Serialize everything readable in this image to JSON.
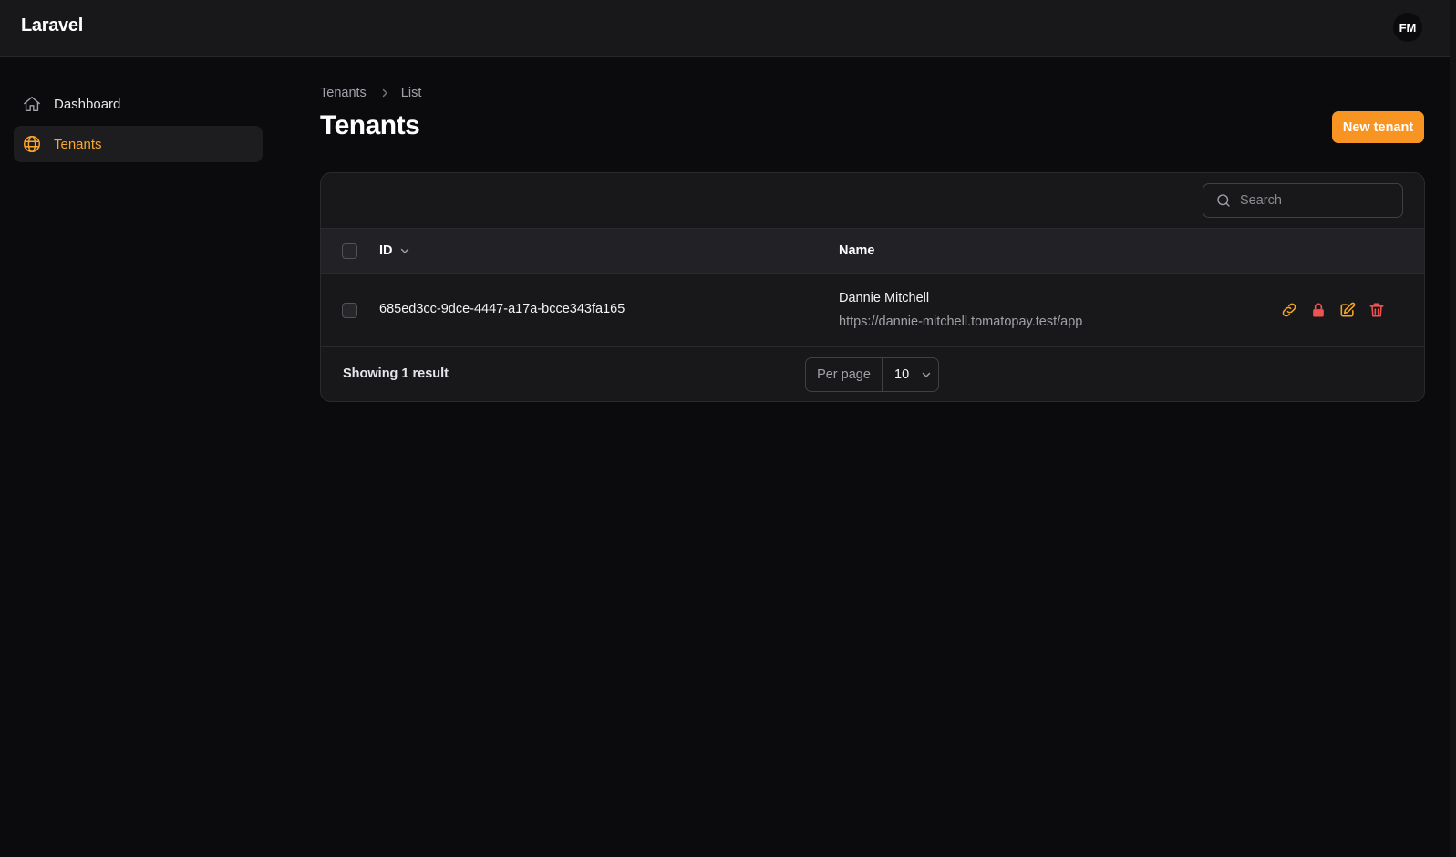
{
  "app": {
    "brand": "Laravel",
    "avatar_initials": "FM"
  },
  "sidebar": {
    "items": [
      {
        "label": "Dashboard",
        "icon": "home-icon",
        "active": false
      },
      {
        "label": "Tenants",
        "icon": "globe-icon",
        "active": true
      }
    ]
  },
  "breadcrumb": {
    "items": [
      "Tenants",
      "List"
    ]
  },
  "page": {
    "title": "Tenants",
    "new_button_label": "New tenant"
  },
  "table": {
    "search_placeholder": "Search",
    "columns": {
      "id": "ID",
      "name": "Name"
    },
    "rows": [
      {
        "id": "685ed3cc-9dce-4447-a17a-bcce343fa165",
        "name": "Dannie Mitchell",
        "url": "https://dannie-mitchell.tomatopay.test/app",
        "actions": [
          "link-icon",
          "lock-icon",
          "edit-icon",
          "trash-icon"
        ]
      }
    ],
    "footer": {
      "result_text": "Showing 1 result",
      "per_page_label": "Per page",
      "per_page_value": "10"
    }
  },
  "colors": {
    "accent": "#f89522",
    "active_nav": "#fba62f",
    "danger": "#f05252",
    "background": "#0b0b0d",
    "surface": "#18181b"
  }
}
